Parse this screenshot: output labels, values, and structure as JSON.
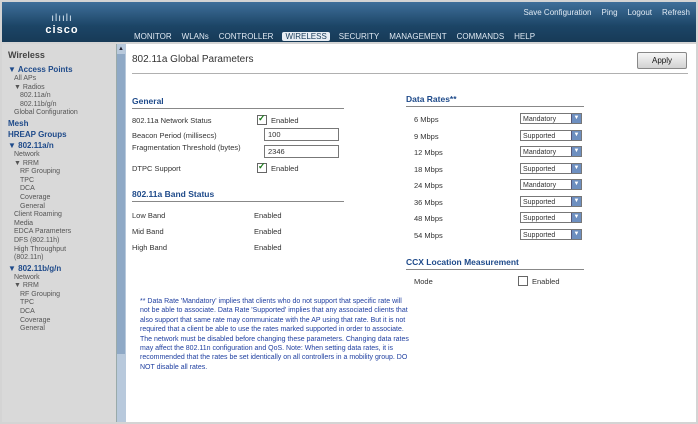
{
  "header": {
    "logo_bars": "ılıılı",
    "logo_word": "cisco",
    "top_links": [
      "Save Configuration",
      "Ping",
      "Logout",
      "Refresh"
    ],
    "menu": [
      {
        "label": "MONITOR",
        "active": false
      },
      {
        "label": "WLANs",
        "active": false
      },
      {
        "label": "CONTROLLER",
        "active": false
      },
      {
        "label": "WIRELESS",
        "active": true
      },
      {
        "label": "SECURITY",
        "active": false
      },
      {
        "label": "MANAGEMENT",
        "active": false
      },
      {
        "label": "COMMANDS",
        "active": false
      },
      {
        "label": "HELP",
        "active": false
      }
    ]
  },
  "sidebar": {
    "title": "Wireless",
    "items": [
      {
        "label": "▼ Access Points",
        "level": "section"
      },
      {
        "label": "All APs",
        "level": "l1"
      },
      {
        "label": "▼ Radios",
        "level": "l1"
      },
      {
        "label": "802.11a/n",
        "level": "l2"
      },
      {
        "label": "802.11b/g/n",
        "level": "l2"
      },
      {
        "label": "Global Configuration",
        "level": "l1"
      },
      {
        "label": "Mesh",
        "level": "section"
      },
      {
        "label": "HREAP Groups",
        "level": "section"
      },
      {
        "label": "▼ 802.11a/n",
        "level": "section"
      },
      {
        "label": "Network",
        "level": "l1"
      },
      {
        "label": "▼ RRM",
        "level": "l1"
      },
      {
        "label": "RF Grouping",
        "level": "l2"
      },
      {
        "label": "TPC",
        "level": "l2"
      },
      {
        "label": "DCA",
        "level": "l2"
      },
      {
        "label": "Coverage",
        "level": "l2"
      },
      {
        "label": "General",
        "level": "l2"
      },
      {
        "label": "Client Roaming",
        "level": "l1"
      },
      {
        "label": "Media",
        "level": "l1"
      },
      {
        "label": "EDCA Parameters",
        "level": "l1"
      },
      {
        "label": "DFS (802.11h)",
        "level": "l1"
      },
      {
        "label": "High Throughput",
        "level": "l1"
      },
      {
        "label": "(802.11n)",
        "level": "l1"
      },
      {
        "label": "▼ 802.11b/g/n",
        "level": "section"
      },
      {
        "label": "Network",
        "level": "l1"
      },
      {
        "label": "▼ RRM",
        "level": "l1"
      },
      {
        "label": "RF Grouping",
        "level": "l2"
      },
      {
        "label": "TPC",
        "level": "l2"
      },
      {
        "label": "DCA",
        "level": "l2"
      },
      {
        "label": "Coverage",
        "level": "l2"
      },
      {
        "label": "General",
        "level": "l2"
      }
    ]
  },
  "page": {
    "title": "802.11a Global Parameters",
    "apply_label": "Apply"
  },
  "general": {
    "heading": "General",
    "network_status_label": "802.11a Network Status",
    "network_status_value": "Enabled",
    "network_status_checked": true,
    "beacon_label": "Beacon Period (millisecs)",
    "beacon_value": "100",
    "frag_label": "Fragmentation Threshold (bytes)",
    "frag_value": "2346",
    "dtpc_label": "DTPC Support",
    "dtpc_value": "Enabled",
    "dtpc_checked": true
  },
  "band": {
    "heading": "802.11a Band Status",
    "rows": [
      {
        "label": "Low Band",
        "value": "Enabled"
      },
      {
        "label": "Mid Band",
        "value": "Enabled"
      },
      {
        "label": "High Band",
        "value": "Enabled"
      }
    ]
  },
  "data_rates": {
    "heading": "Data Rates**",
    "rows": [
      {
        "label": "6 Mbps",
        "value": "Mandatory"
      },
      {
        "label": "9 Mbps",
        "value": "Supported"
      },
      {
        "label": "12 Mbps",
        "value": "Mandatory"
      },
      {
        "label": "18 Mbps",
        "value": "Supported"
      },
      {
        "label": "24 Mbps",
        "value": "Mandatory"
      },
      {
        "label": "36 Mbps",
        "value": "Supported"
      },
      {
        "label": "48 Mbps",
        "value": "Supported"
      },
      {
        "label": "54 Mbps",
        "value": "Supported"
      }
    ]
  },
  "ccx": {
    "heading": "CCX Location Measurement",
    "mode_label": "Mode",
    "mode_value": "Enabled",
    "mode_checked": false
  },
  "footnote": "** Data Rate 'Mandatory' implies that clients who do not support that specific rate will not be able to associate. Data Rate 'Supported' implies that any associated clients that also support that same rate may communicate with the AP using that rate. But it is not required that a client be able to use the rates marked supported in order to associate. The network must be disabled before changing these parameters. Changing data rates may affect the 802.11n configuration and QoS. Note: When setting data rates, it is recommended that the rates be set identically on all controllers in a mobility group. DO NOT disable all rates."
}
